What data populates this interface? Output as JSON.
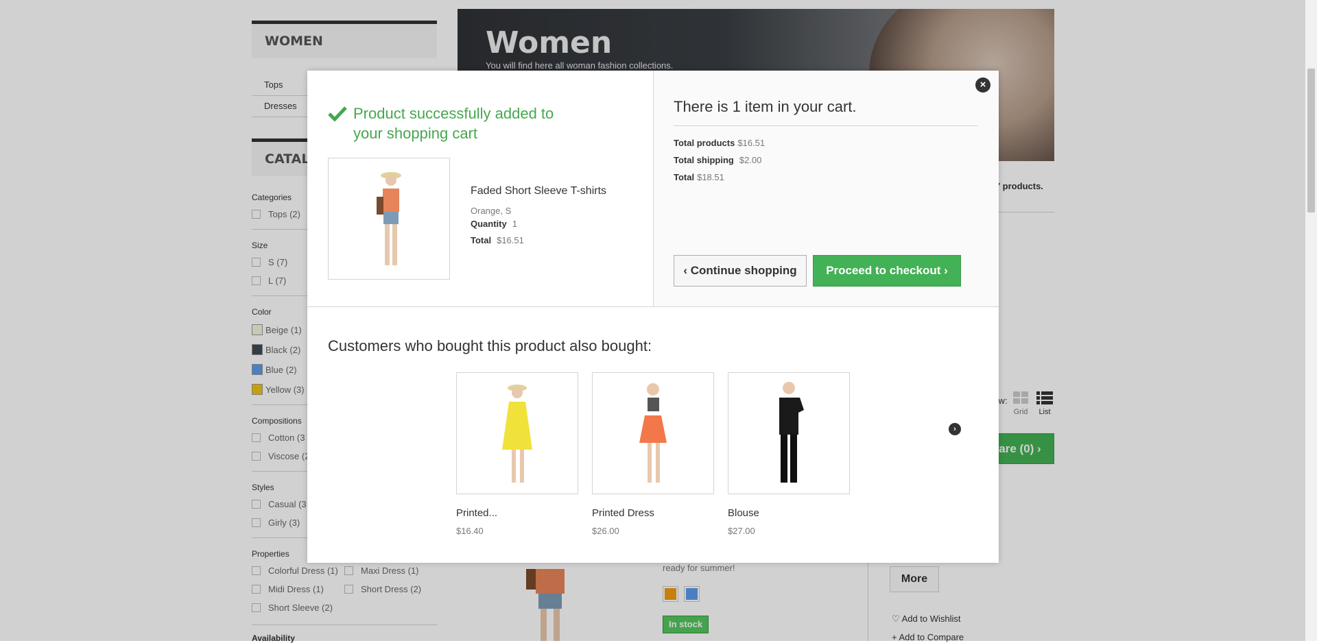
{
  "sidebar": {
    "women_title": "WOMEN",
    "categories": [
      "Tops",
      "Dresses"
    ],
    "catalog_title": "CATAL",
    "filters": {
      "categories_label": "Categories",
      "categories": [
        "Tops (2)"
      ],
      "size_label": "Size",
      "sizes": [
        "S (7)",
        "L (7)"
      ],
      "color_label": "Color",
      "colors": [
        {
          "label": "Beige (1)",
          "color": "#f5f5dc"
        },
        {
          "label": "Black (2)",
          "color": "#434a54"
        },
        {
          "label": "Blue (2)",
          "color": "#5d9cec"
        },
        {
          "label": "Yellow (3)",
          "color": "#f1c40f"
        }
      ],
      "compositions_label": "Compositions",
      "compositions": [
        "Cotton (3",
        "Viscose (2"
      ],
      "styles_label": "Styles",
      "styles": [
        "Casual (3",
        "Girly (3)"
      ],
      "properties_label": "Properties",
      "properties": [
        "Colorful Dress (1)",
        "Maxi Dress (1)",
        "Midi Dress (1)",
        "Short Dress (2)",
        "Short Sleeve (2)"
      ],
      "availability_label": "Availability"
    }
  },
  "banner": {
    "title": "Women",
    "subtitle": "You will find here all woman fashion collections."
  },
  "background": {
    "products_count_tail": "e 7 products.",
    "view_label": "View:",
    "grid_label": "Grid",
    "list_label": "List",
    "compare_label": "are (0)",
    "product_desc_tail": "ready for summer!",
    "in_stock": "In stock",
    "more_label": "More",
    "wishlist_label": "Add to Wishlist",
    "compare_link": "Add to Compare",
    "swatches": [
      "#f39c11",
      "#5d9cec"
    ]
  },
  "modal": {
    "success_message": "Product successfully added to your shopping cart",
    "product": {
      "name": "Faded Short Sleeve T-shirts",
      "attributes": "Orange, S",
      "quantity_label": "Quantity",
      "quantity": "1",
      "total_label": "Total",
      "total": "$16.51"
    },
    "cart": {
      "count_text": "There is 1 item in your cart.",
      "total_products_label": "Total products",
      "total_products": "$16.51",
      "total_shipping_label": "Total shipping",
      "total_shipping": "$2.00",
      "total_label": "Total",
      "total": "$18.51"
    },
    "continue_label": "Continue shopping",
    "checkout_label": "Proceed to checkout",
    "crosssell_title": "Customers who bought this product also bought:",
    "crosssell": [
      {
        "name": "Printed...",
        "price": "$16.40",
        "dress_color": "#f0e23a"
      },
      {
        "name": "Printed Dress",
        "price": "$26.00",
        "dress_color": "#f2784b"
      },
      {
        "name": "Blouse",
        "price": "$27.00",
        "dress_color": "#1a1a1a"
      }
    ]
  },
  "colors": {
    "success_green": "#46a74e",
    "checkout_green": "#43b155"
  }
}
